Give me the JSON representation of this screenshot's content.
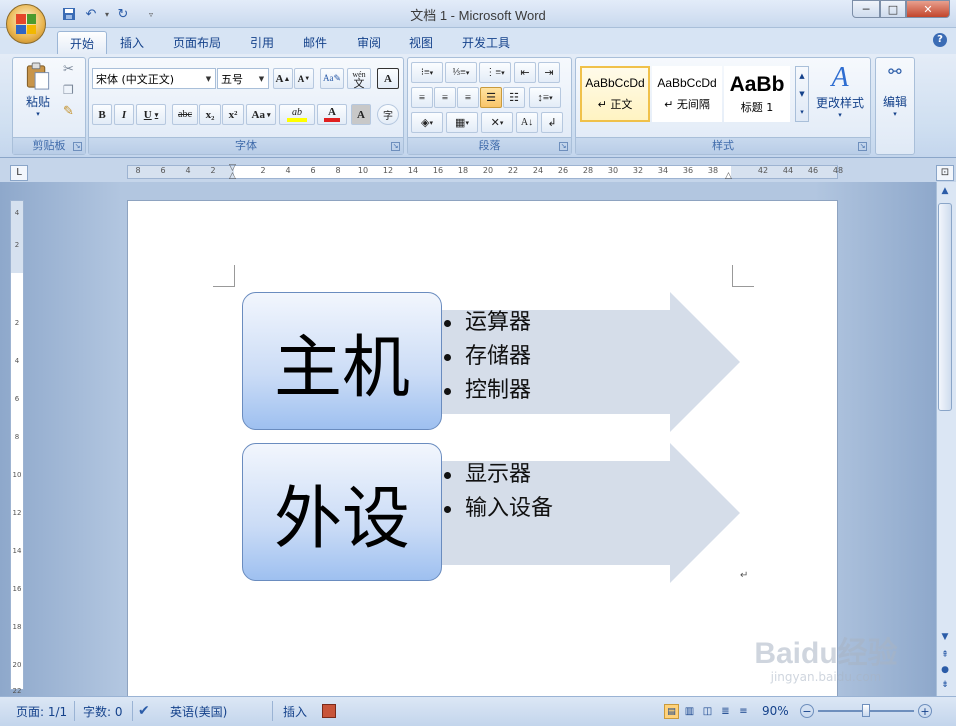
{
  "window": {
    "title": "文档 1 - Microsoft Word",
    "controls": {
      "minimize": "─",
      "maximize": "□",
      "close": "✕"
    }
  },
  "qat": {
    "save_icon": "save-icon",
    "undo_icon": "undo-icon",
    "redo_icon": "redo-icon",
    "customize_icon": "chevron-down-icon"
  },
  "tabs": [
    {
      "label": "开始",
      "active": true
    },
    {
      "label": "插入"
    },
    {
      "label": "页面布局"
    },
    {
      "label": "引用"
    },
    {
      "label": "邮件"
    },
    {
      "label": "审阅"
    },
    {
      "label": "视图"
    },
    {
      "label": "开发工具"
    }
  ],
  "ribbon": {
    "clipboard": {
      "label": "剪贴板",
      "paste_label": "粘贴"
    },
    "font": {
      "label": "字体",
      "font_name": "宋体 (中文正文)",
      "font_size": "五号",
      "bold": "B",
      "italic": "I",
      "underline": "U",
      "strike": "abc",
      "subscript": "x₂",
      "superscript": "x²",
      "change_case": "Aa",
      "grow": "A",
      "shrink": "A",
      "char_border": "A",
      "char_shading": "A",
      "enclose": "字",
      "phonetic": "wén",
      "highlight": "ab",
      "font_color": "A"
    },
    "paragraph": {
      "label": "段落"
    },
    "styles": {
      "label": "样式",
      "items": [
        {
          "preview": "AaBbCcDd",
          "name": "↵ 正文"
        },
        {
          "preview": "AaBbCcDd",
          "name": "↵ 无间隔"
        },
        {
          "preview": "AaBb",
          "name": "标题 1"
        }
      ],
      "change_styles": "更改样式"
    },
    "editing": {
      "label": "编辑"
    }
  },
  "hruler_ticks": [
    "8",
    "6",
    "4",
    "2",
    "2",
    "4",
    "6",
    "8",
    "10",
    "12",
    "14",
    "16",
    "18",
    "20",
    "22",
    "24",
    "26",
    "28",
    "30",
    "32",
    "34",
    "36",
    "38",
    "42",
    "44",
    "46",
    "48"
  ],
  "vruler_ticks": [
    "4",
    "2",
    "2",
    "4",
    "6",
    "8",
    "10",
    "12",
    "14",
    "16",
    "18",
    "20",
    "22"
  ],
  "smartart": [
    {
      "title": "主机",
      "items": [
        "运算器",
        "存储器",
        "控制器"
      ]
    },
    {
      "title": "外设",
      "items": [
        "显示器",
        "输入设备"
      ]
    }
  ],
  "paragraph_mark": "↵",
  "status": {
    "page": "页面: 1/1",
    "words": "字数: 0",
    "language": "英语(美国)",
    "mode": "插入",
    "zoom": "90%",
    "zoom_level": 0.5
  },
  "watermark": {
    "brand": "Baidu经验",
    "url": "jingyan.baidu.com"
  },
  "colors": {
    "accent": "#15428b",
    "smartart_fill": "#9ec0f0",
    "arrow_fill": "#d5dde9"
  }
}
